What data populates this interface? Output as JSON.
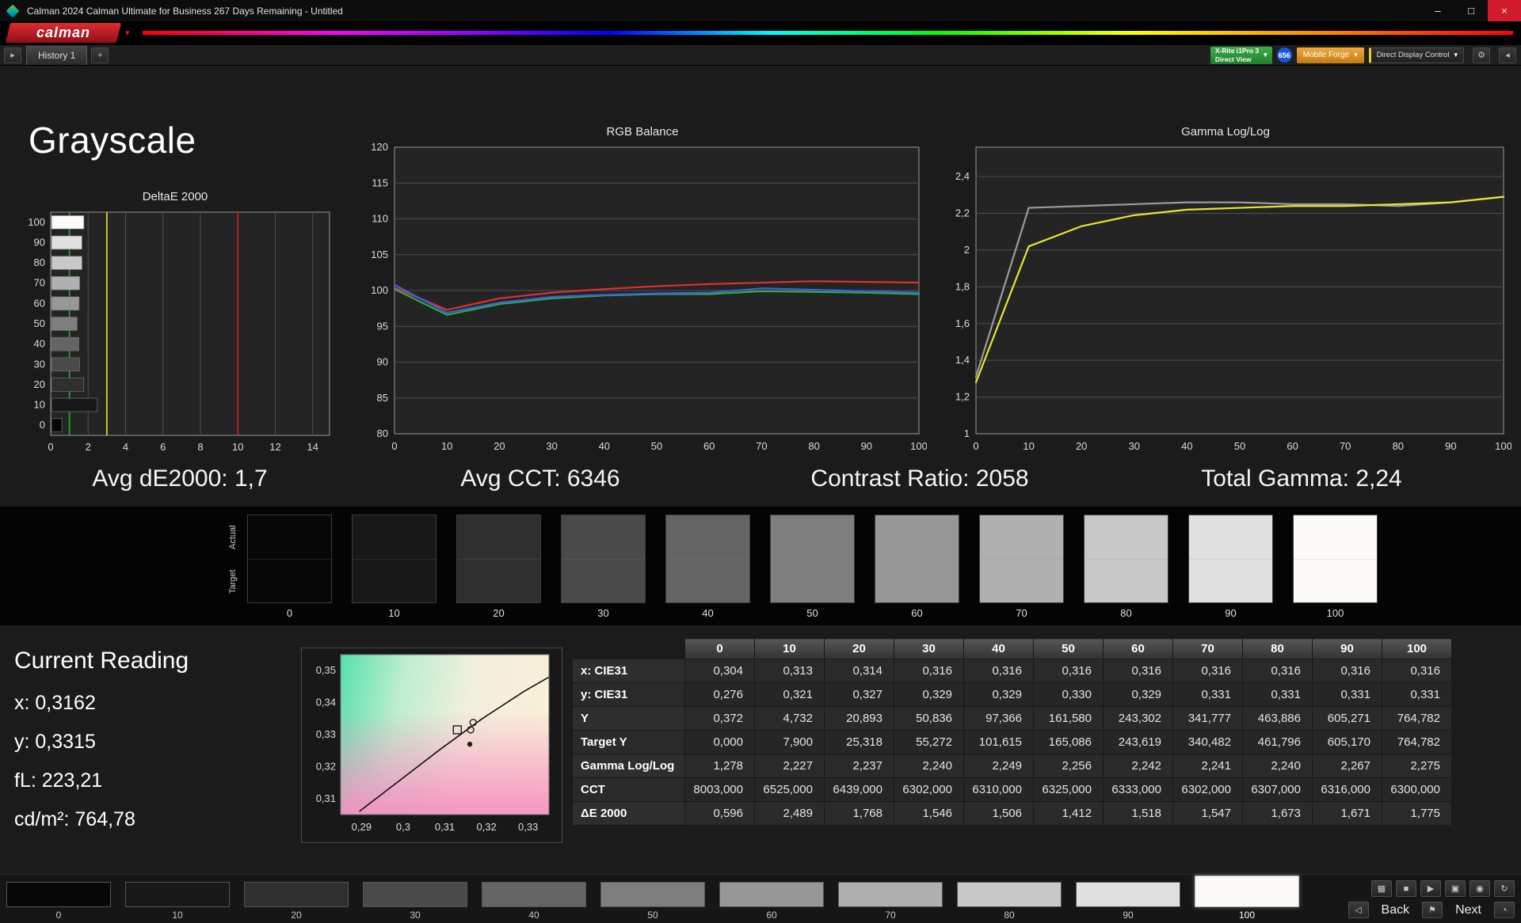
{
  "window": {
    "title": "Calman 2024 Calman Ultimate for Business 267 Days Remaining  - Untitled",
    "minimize": "–",
    "maximize": "□",
    "close": "×"
  },
  "brand": {
    "logo_text": "calman",
    "caret": "▾"
  },
  "tab_bar": {
    "history_nav": "▸",
    "history_tab": "History 1",
    "add_tab": "+",
    "meter_device_line1": "X-Rite i1Pro 3",
    "meter_device_line2": "Direct View",
    "badge": "656",
    "source_device": "Mobile Forge",
    "display_control": "Direct Display Control",
    "caret": "▾",
    "gear_glyph": "⚙",
    "collapse_glyph": "◂"
  },
  "page": {
    "title": "Grayscale"
  },
  "stats": {
    "avg_de": "Avg dE2000: 1,7",
    "avg_cct": "Avg CCT: 6346",
    "contrast": "Contrast Ratio: 2058",
    "gamma": "Total Gamma: 2,24"
  },
  "swatch_strip": {
    "row_label_top": "Actual",
    "row_label_bottom": "Target",
    "levels": [
      "0",
      "10",
      "20",
      "30",
      "40",
      "50",
      "60",
      "70",
      "80",
      "90",
      "100"
    ],
    "colors": [
      "#070707",
      "#181818",
      "#2f2f2f",
      "#4a4a4a",
      "#646464",
      "#7e7e7e",
      "#979797",
      "#b0b0b0",
      "#c8c8c8",
      "#e0e0e0",
      "#fbfaf7"
    ]
  },
  "current_reading": {
    "title": "Current Reading",
    "x": "x: 0,3162",
    "y": "y: 0,3315",
    "fl": "fL: 223,21",
    "cdm2": "cd/m²: 764,78"
  },
  "table": {
    "columns": [
      "0",
      "10",
      "20",
      "30",
      "40",
      "50",
      "60",
      "70",
      "80",
      "90",
      "100"
    ],
    "rows": [
      {
        "label": "x: CIE31",
        "values": [
          "0,304",
          "0,313",
          "0,314",
          "0,316",
          "0,316",
          "0,316",
          "0,316",
          "0,316",
          "0,316",
          "0,316",
          "0,316"
        ]
      },
      {
        "label": "y: CIE31",
        "values": [
          "0,276",
          "0,321",
          "0,327",
          "0,329",
          "0,329",
          "0,330",
          "0,329",
          "0,331",
          "0,331",
          "0,331",
          "0,331"
        ]
      },
      {
        "label": "Y",
        "values": [
          "0,372",
          "4,732",
          "20,893",
          "50,836",
          "97,366",
          "161,580",
          "243,302",
          "341,777",
          "463,886",
          "605,271",
          "764,782"
        ]
      },
      {
        "label": "Target Y",
        "values": [
          "0,000",
          "7,900",
          "25,318",
          "55,272",
          "101,615",
          "165,086",
          "243,619",
          "340,482",
          "461,796",
          "605,170",
          "764,782"
        ]
      },
      {
        "label": "Gamma Log/Log",
        "values": [
          "1,278",
          "2,227",
          "2,237",
          "2,240",
          "2,249",
          "2,256",
          "2,242",
          "2,241",
          "2,240",
          "2,267",
          "2,275"
        ]
      },
      {
        "label": "CCT",
        "values": [
          "8003,000",
          "6525,000",
          "6439,000",
          "6302,000",
          "6310,000",
          "6325,000",
          "6333,000",
          "6302,000",
          "6307,000",
          "6316,000",
          "6300,000"
        ]
      },
      {
        "label": "ΔE 2000",
        "values": [
          "0,596",
          "2,489",
          "1,768",
          "1,546",
          "1,506",
          "1,412",
          "1,518",
          "1,547",
          "1,673",
          "1,671",
          "1,775"
        ]
      }
    ]
  },
  "footer": {
    "patch_levels": [
      "0",
      "10",
      "20",
      "30",
      "40",
      "50",
      "60",
      "70",
      "80",
      "90",
      "100"
    ],
    "selected_level": "100",
    "icons_top": [
      {
        "name": "pattern-window-icon",
        "glyph": "▦"
      },
      {
        "name": "stop-icon",
        "glyph": "■"
      },
      {
        "name": "play-icon",
        "glyph": "▶"
      },
      {
        "name": "save-icon",
        "glyph": "▣"
      },
      {
        "name": "record-icon",
        "glyph": "◉"
      },
      {
        "name": "refresh-icon",
        "glyph": "↻"
      }
    ],
    "speaker_glyph": "◁",
    "bookmark_glyph": "⚑",
    "gauge_glyph": "◔",
    "back_label": "Back",
    "next_label": "Next"
  },
  "chart_data": [
    {
      "type": "bar",
      "title": "DeltaE 2000",
      "orientation": "horizontal",
      "categories": [
        "100",
        "90",
        "80",
        "70",
        "60",
        "50",
        "40",
        "30",
        "20",
        "10",
        "0"
      ],
      "values": [
        1.775,
        1.671,
        1.673,
        1.547,
        1.518,
        1.412,
        1.506,
        1.546,
        1.768,
        2.489,
        0.596
      ],
      "xlim": [
        0,
        14.9
      ],
      "xticks": [
        0,
        2,
        4,
        6,
        8,
        10,
        12,
        14
      ],
      "reference_lines": [
        {
          "x": 1,
          "color": "#1fa32a"
        },
        {
          "x": 3,
          "color": "#d6d31f"
        },
        {
          "x": 10,
          "color": "#cc1f1f"
        }
      ]
    },
    {
      "type": "line",
      "title": "RGB Balance",
      "x": [
        0,
        10,
        20,
        30,
        40,
        50,
        60,
        70,
        80,
        90,
        100
      ],
      "ylim": [
        80,
        120
      ],
      "yticks": [
        80,
        85,
        90,
        95,
        100,
        105,
        110,
        115,
        120
      ],
      "series": [
        {
          "name": "Red",
          "color": "#e03030",
          "values": [
            100.4,
            97.3,
            98.9,
            99.7,
            100.2,
            100.6,
            100.9,
            101.1,
            101.3,
            101.2,
            101.1
          ]
        },
        {
          "name": "Green",
          "color": "#2fae3a",
          "values": [
            100.2,
            96.6,
            98.1,
            98.9,
            99.3,
            99.5,
            99.5,
            99.9,
            99.8,
            99.7,
            99.5
          ]
        },
        {
          "name": "Blue",
          "color": "#3b5fe8",
          "values": [
            100.8,
            96.9,
            98.3,
            99.1,
            99.4,
            99.6,
            99.7,
            100.3,
            100.1,
            99.9,
            99.7
          ]
        }
      ]
    },
    {
      "type": "line",
      "title": "Gamma Log/Log",
      "x": [
        0,
        10,
        20,
        30,
        40,
        50,
        60,
        70,
        80,
        90,
        100
      ],
      "ylim": [
        1,
        2.56
      ],
      "yticks": [
        1,
        1.2,
        1.4,
        1.6,
        1.8,
        2,
        2.2,
        2.4
      ],
      "ytick_labels": [
        "1",
        "1,2",
        "1,4",
        "1,6",
        "1,8",
        "2",
        "2,2",
        "2,4"
      ],
      "series": [
        {
          "name": "Target",
          "color": "#9b9b9b",
          "values": [
            1.31,
            2.23,
            2.24,
            2.25,
            2.26,
            2.26,
            2.25,
            2.25,
            2.24,
            2.26,
            2.29
          ]
        },
        {
          "name": "Measured",
          "color": "#e8e432",
          "values": [
            1.28,
            2.02,
            2.13,
            2.19,
            2.22,
            2.23,
            2.24,
            2.24,
            2.25,
            2.26,
            2.29
          ]
        }
      ]
    },
    {
      "type": "scatter",
      "title": "CIE 1931 xy",
      "xlim": [
        0.285,
        0.335
      ],
      "xticks": [
        0.29,
        0.3,
        0.31,
        0.32,
        0.33
      ],
      "xtick_labels": [
        "0,29",
        "0,3",
        "0,31",
        "0,32",
        "0,33"
      ],
      "ylim": [
        0.305,
        0.355
      ],
      "yticks": [
        0.31,
        0.32,
        0.33,
        0.34,
        0.35
      ],
      "ytick_labels": [
        "0,31",
        "0,32",
        "0,33",
        "0,34",
        "0,35"
      ],
      "locus": [
        [
          0.2895,
          0.306
        ],
        [
          0.299,
          0.3155
        ],
        [
          0.309,
          0.3255
        ],
        [
          0.319,
          0.335
        ],
        [
          0.329,
          0.3435
        ],
        [
          0.335,
          0.348
        ]
      ],
      "target": {
        "x": 0.313,
        "y": 0.3315
      },
      "points": [
        {
          "x": 0.3162,
          "y": 0.3315,
          "style": "circle"
        },
        {
          "x": 0.3168,
          "y": 0.3338,
          "style": "circle"
        },
        {
          "x": 0.316,
          "y": 0.327,
          "style": "dot"
        }
      ]
    }
  ]
}
